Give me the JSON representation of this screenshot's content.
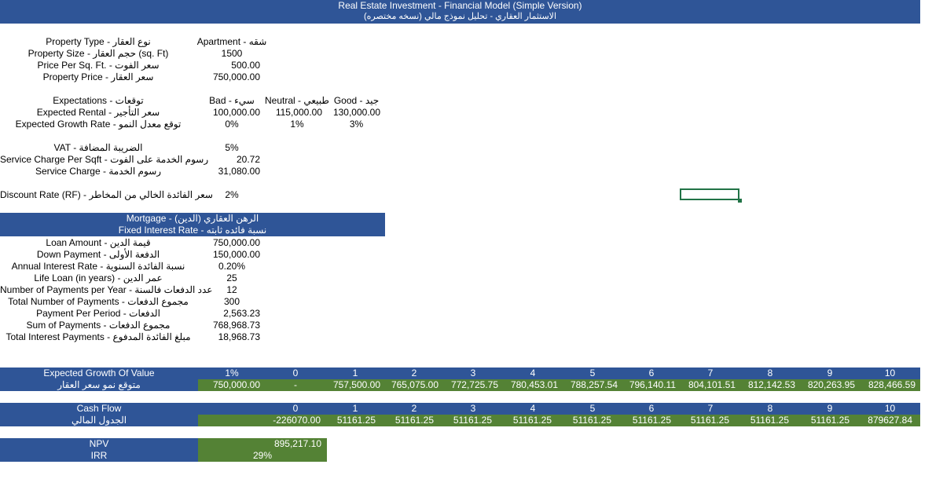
{
  "header": {
    "title": "Real Estate Investment - Financial Model (Simple Version)",
    "subtitle": "الاستثمار العقاري - تحليل نموذج مالي (نسخه مختصره)"
  },
  "property": [
    {
      "label": "Property Type - نوع العقار",
      "value": "Apartment - شقه"
    },
    {
      "label": "Property Size - حجم العقار (sq. Ft)",
      "value": "1500"
    },
    {
      "label": "Price Per Sq. Ft. - سعر الفوت",
      "value": "500.00"
    },
    {
      "label": "Property Price - سعر العقار",
      "value": "750,000.00"
    }
  ],
  "expectations": {
    "label": "Expectations - توقعات",
    "columns": [
      "Bad - سيء",
      "Neutral - طبيعي",
      "Good - جيد"
    ],
    "rental_label": "Expected Rental - سعر التأجير",
    "rental": [
      "100,000.00",
      "115,000.00",
      "130,000.00"
    ],
    "growth_label": "Expected Growth Rate - توقع معدل النمو",
    "growth": [
      "0%",
      "1%",
      "3%"
    ]
  },
  "charges": [
    {
      "label": "VAT - الضريبة المضافة",
      "value": "5%"
    },
    {
      "label": "Service Charge Per Sqft - رسوم الخدمة على الفوت",
      "value": "20.72"
    },
    {
      "label": "Service Charge - رسوم الخدمة",
      "value": "31,080.00"
    }
  ],
  "discount": {
    "label": "Discount Rate (RF) - سعر الفائدة الخالي من المخاطر",
    "value": "2%"
  },
  "mortgage": {
    "title": "Mortgage - الرهن العقاري (الدين)",
    "subtitle": "Fixed Interest Rate - نسبة فائده ثابته",
    "rows": [
      {
        "label": "Loan Amount - قيمة الدين",
        "value": "750,000.00"
      },
      {
        "label": "Down Payment - الدفعة الأولى",
        "value": "150,000.00"
      },
      {
        "label": "Annual Interest Rate - نسبة الفائدة السنوية",
        "value": "0.20%"
      },
      {
        "label": "Life Loan (in years) - عمر الدين",
        "value": "25"
      },
      {
        "label": "Number of Payments per Year - عدد الدفعات فالسنة",
        "value": "12"
      },
      {
        "label": "Total Number of Payments - مجموع الدفعات",
        "value": "300"
      },
      {
        "label": "Payment Per Period - الدفعات",
        "value": "2,563.23"
      },
      {
        "label": "Sum of Payments - مجموع الدفعات",
        "value": "768,968.73"
      },
      {
        "label": "Total Interest Payments - مبلغ الفائدة المدفوع",
        "value": "18,968.73"
      }
    ]
  },
  "growth_table": {
    "label": "Expected Growth Of Value",
    "label_ar": "متوقع نمو سعر العقار",
    "rate": "1%",
    "years": [
      "0",
      "1",
      "2",
      "3",
      "4",
      "5",
      "6",
      "7",
      "8",
      "9",
      "10"
    ],
    "base": "750,000.00",
    "values": [
      "-",
      "757,500.00",
      "765,075.00",
      "772,725.75",
      "780,453.01",
      "788,257.54",
      "796,140.11",
      "804,101.51",
      "812,142.53",
      "820,263.95",
      "828,466.59"
    ]
  },
  "cashflow_table": {
    "label": "Cash Flow",
    "label_ar": "الجدول المالي",
    "years": [
      "0",
      "1",
      "2",
      "3",
      "4",
      "5",
      "6",
      "7",
      "8",
      "9",
      "10"
    ],
    "values": [
      "-226070.00",
      "51161.25",
      "51161.25",
      "51161.25",
      "51161.25",
      "51161.25",
      "51161.25",
      "51161.25",
      "51161.25",
      "51161.25",
      "879627.84"
    ]
  },
  "results": {
    "npv_label": "NPV",
    "npv": "895,217.10",
    "irr_label": "IRR",
    "irr": "29%"
  },
  "colors": {
    "header_blue": "#2f5597",
    "value_green": "#548235",
    "selection_green": "#217346"
  }
}
